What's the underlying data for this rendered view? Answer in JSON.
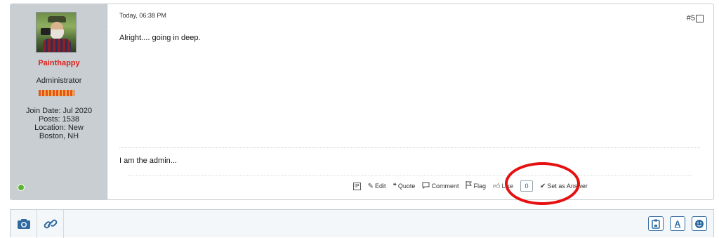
{
  "post": {
    "user": {
      "username": "Painthappy",
      "title": "Administrator",
      "join_date": "Join Date: Jul 2020",
      "posts": "Posts: 1538",
      "location_line1": "Location: New",
      "location_line2": "Boston, NH",
      "status": "online"
    },
    "date": "Today, 06:38 PM",
    "number": "#5",
    "message": "Alright.... going in deep.",
    "signature": "I am the admin..."
  },
  "actions": {
    "ip_label": "IP",
    "edit_label": "Edit",
    "quote_label": "Quote",
    "comment_label": "Comment",
    "flag_label": "Flag",
    "like_label": "Like",
    "like_count": "0",
    "answer_label": "Set as Answer"
  },
  "colors": {
    "username": "#e0201b",
    "annotation_circle": "#e61010",
    "online_dot": "#5bb531",
    "accent": "#2f6aa1"
  },
  "icons": {
    "editor_left": [
      "camera-icon",
      "link-icon"
    ],
    "editor_right": [
      "paste-icon",
      "text-format-icon",
      "emoji-icon"
    ]
  }
}
